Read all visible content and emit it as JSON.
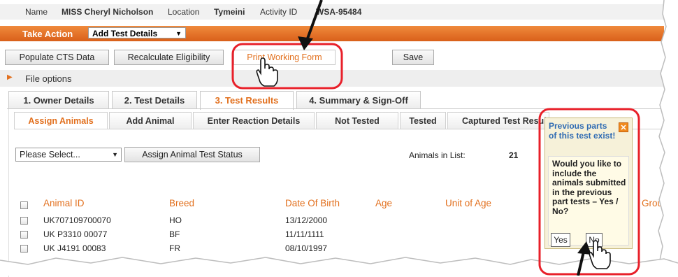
{
  "header": {
    "name_label": "Name",
    "name_value": "MISS Cheryl Nicholson",
    "location_label": "Location",
    "location_value": "Tymeini",
    "activity_label": "Activity ID",
    "activity_value": "WSA-95484"
  },
  "action_bar": {
    "label": "Take Action",
    "selected": "Add Test Details"
  },
  "toolbar": {
    "populate": "Populate CTS Data",
    "recalculate": "Recalculate Eligibility",
    "print": "Print Working Form",
    "save": "Save"
  },
  "file_options": "File options",
  "main_tabs": [
    {
      "label": "1. Owner Details"
    },
    {
      "label": "2. Test Details"
    },
    {
      "label": "3. Test Results"
    },
    {
      "label": "4. Summary & Sign-Off"
    }
  ],
  "sub_tabs": [
    {
      "label": "Assign Animals"
    },
    {
      "label": "Add Animal"
    },
    {
      "label": "Enter Reaction Details"
    },
    {
      "label": "Not Tested"
    },
    {
      "label": "Tested"
    },
    {
      "label": "Captured Test Results"
    }
  ],
  "controls": {
    "select_placeholder": "Please Select...",
    "assign_button": "Assign Animal Test Status",
    "count_label": "Animals in List:",
    "count_value": "21"
  },
  "table": {
    "columns": [
      "Animal ID",
      "Breed",
      "Date Of Birth",
      "Age",
      "Unit of Age",
      "Group"
    ],
    "rows": [
      [
        "UK707109700070",
        "HO",
        "13/12/2000"
      ],
      [
        "UK P3310 00077",
        "BF",
        "11/11/1111"
      ],
      [
        "UK J4191 00083",
        "FR",
        "08/10/1997"
      ]
    ]
  },
  "popup": {
    "title": "Previous parts of this test exist!",
    "body": "Would you like to include the animals submitted in the previous part tests – Yes / No?",
    "yes": "Yes",
    "no": "No",
    "close_icon": "close-icon"
  },
  "colors": {
    "accent": "#e2701e",
    "annotation": "#e8202a",
    "popup_bg": "#f6f1d9",
    "link_blue": "#2f6bb3"
  }
}
